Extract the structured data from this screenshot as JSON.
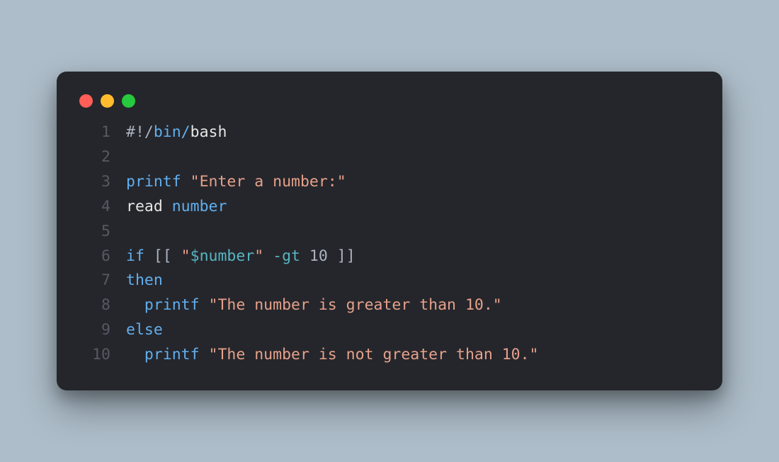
{
  "lights": [
    "red",
    "yellow",
    "green"
  ],
  "code": {
    "lines": [
      {
        "n": "1",
        "tokens": [
          {
            "t": "#!/",
            "c": "c-gray"
          },
          {
            "t": "bin/",
            "c": "c-blue"
          },
          {
            "t": "bash",
            "c": "c-white"
          }
        ]
      },
      {
        "n": "2",
        "tokens": []
      },
      {
        "n": "3",
        "tokens": [
          {
            "t": "printf",
            "c": "c-blue"
          },
          {
            "t": " ",
            "c": "c-default"
          },
          {
            "t": "\"Enter a number:\"",
            "c": "c-salmon"
          }
        ]
      },
      {
        "n": "4",
        "tokens": [
          {
            "t": "read",
            "c": "c-white"
          },
          {
            "t": " ",
            "c": "c-default"
          },
          {
            "t": "number",
            "c": "c-blue"
          }
        ]
      },
      {
        "n": "5",
        "tokens": []
      },
      {
        "n": "6",
        "tokens": [
          {
            "t": "if",
            "c": "c-blue"
          },
          {
            "t": " [[ ",
            "c": "c-default"
          },
          {
            "t": "\"",
            "c": "c-salmon"
          },
          {
            "t": "$number",
            "c": "c-teal"
          },
          {
            "t": "\"",
            "c": "c-salmon"
          },
          {
            "t": " ",
            "c": "c-default"
          },
          {
            "t": "-gt",
            "c": "c-op"
          },
          {
            "t": " 10 ]]",
            "c": "c-default"
          }
        ]
      },
      {
        "n": "7",
        "tokens": [
          {
            "t": "then",
            "c": "c-blue"
          }
        ]
      },
      {
        "n": "8",
        "tokens": [
          {
            "t": "  ",
            "c": "c-default"
          },
          {
            "t": "printf",
            "c": "c-blue"
          },
          {
            "t": " ",
            "c": "c-default"
          },
          {
            "t": "\"The number is greater than 10.\"",
            "c": "c-salmon"
          }
        ]
      },
      {
        "n": "9",
        "tokens": [
          {
            "t": "else",
            "c": "c-blue"
          }
        ]
      },
      {
        "n": "10",
        "tokens": [
          {
            "t": "  ",
            "c": "c-default"
          },
          {
            "t": "printf",
            "c": "c-blue"
          },
          {
            "t": " ",
            "c": "c-default"
          },
          {
            "t": "\"The number is not greater than 10.\"",
            "c": "c-salmon"
          }
        ]
      }
    ]
  }
}
